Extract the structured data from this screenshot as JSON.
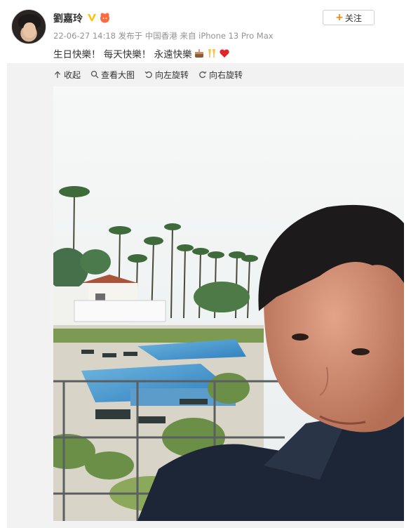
{
  "user": {
    "name": "劉嘉玲",
    "timestamp": "22-06-27 14:18",
    "location": "发布于 中国香港",
    "source": "来自 iPhone 13 Pro Max"
  },
  "actions": {
    "follow_label": "关注"
  },
  "post": {
    "text": "生日快樂！ 每天快樂！ 永遠快樂",
    "emojis": [
      "cake-emoji",
      "cheers-emoji",
      "heart-emoji"
    ]
  },
  "toolbar": [
    {
      "label": "收起",
      "icon": "collapse-icon"
    },
    {
      "label": "查看大图",
      "icon": "search-icon"
    },
    {
      "label": "向左旋转",
      "icon": "rotate-left-icon"
    },
    {
      "label": "向右旋转",
      "icon": "rotate-right-icon"
    }
  ],
  "colors": {
    "accent": "#ff8200",
    "verify": "#ffc107",
    "meta_text": "#939393"
  }
}
